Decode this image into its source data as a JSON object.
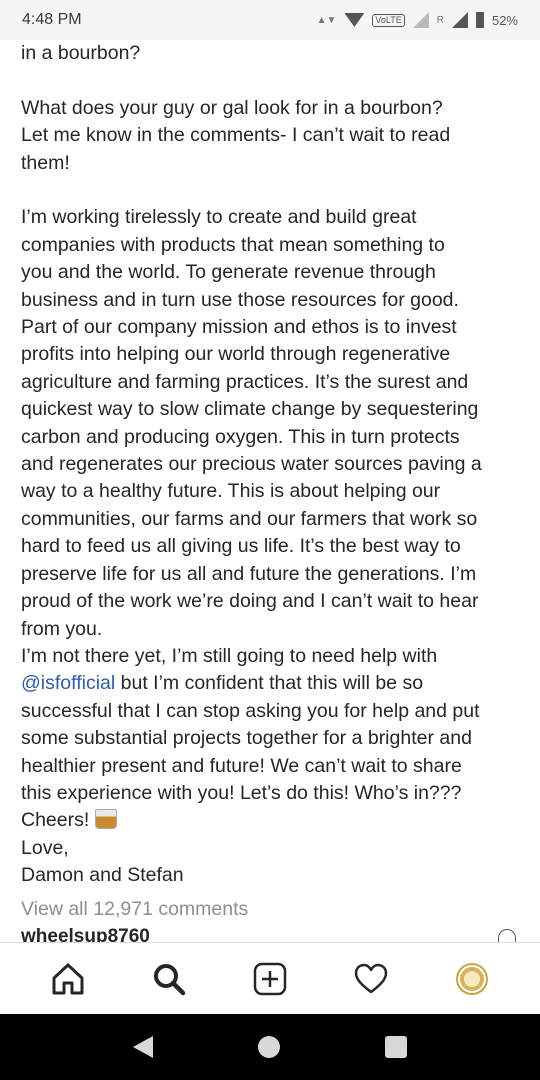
{
  "status": {
    "time": "4:48 PM",
    "volte": "VoLTE",
    "roaming": "R",
    "battery": "52%"
  },
  "caption": {
    "line_top": "in a bourbon?",
    "para_question": "What does your guy or gal look for in a bourbon?\nLet me know in the comments- I can’t wait to read\nthem!",
    "para_mission": "I’m working tirelessly to create and build great\ncompanies with products that mean something to\nyou and the world. To generate revenue through\nbusiness and in turn use those resources for good.\nPart of our company mission and ethos is to invest\nprofits into helping our world through regenerative\nagriculture and farming practices. It’s the surest and\nquickest way to slow climate change by sequestering\ncarbon and producing oxygen. This in turn protects\nand regenerates our precious water sources paving a\nway to a healthy future. This is about helping our\ncommunities, our farms and our farmers that work so\nhard to feed us all giving us life. It’s the best way to\npreserve life for us all and future the generations. I’m\nproud of the work we’re doing and I can’t wait to hear\nfrom you.",
    "para_help_1": "I’m not there yet, I’m still going to need help with",
    "mention": "@isfofficial",
    "para_help_2": " but I’m confident that this will be so\nsuccessful that I can stop asking you for help and put\nsome substantial projects together for a brighter and\nhealthier present and future! We can’t wait to share\nthis experience with you! Let’s do this! Who’s in???",
    "cheers": "Cheers!",
    "love": "Love,",
    "signature": "Damon and Stefan"
  },
  "comments": {
    "view_all": "View all 12,971 comments",
    "first_commenter": "wheelsup8760"
  },
  "tab_bar": {
    "items": [
      "home-icon",
      "search-icon",
      "new-post-icon",
      "activity-heart-icon",
      "profile-avatar"
    ]
  },
  "colors": {
    "text": "#262626",
    "mention": "#2a5db0",
    "muted": "#8e8e8e"
  }
}
